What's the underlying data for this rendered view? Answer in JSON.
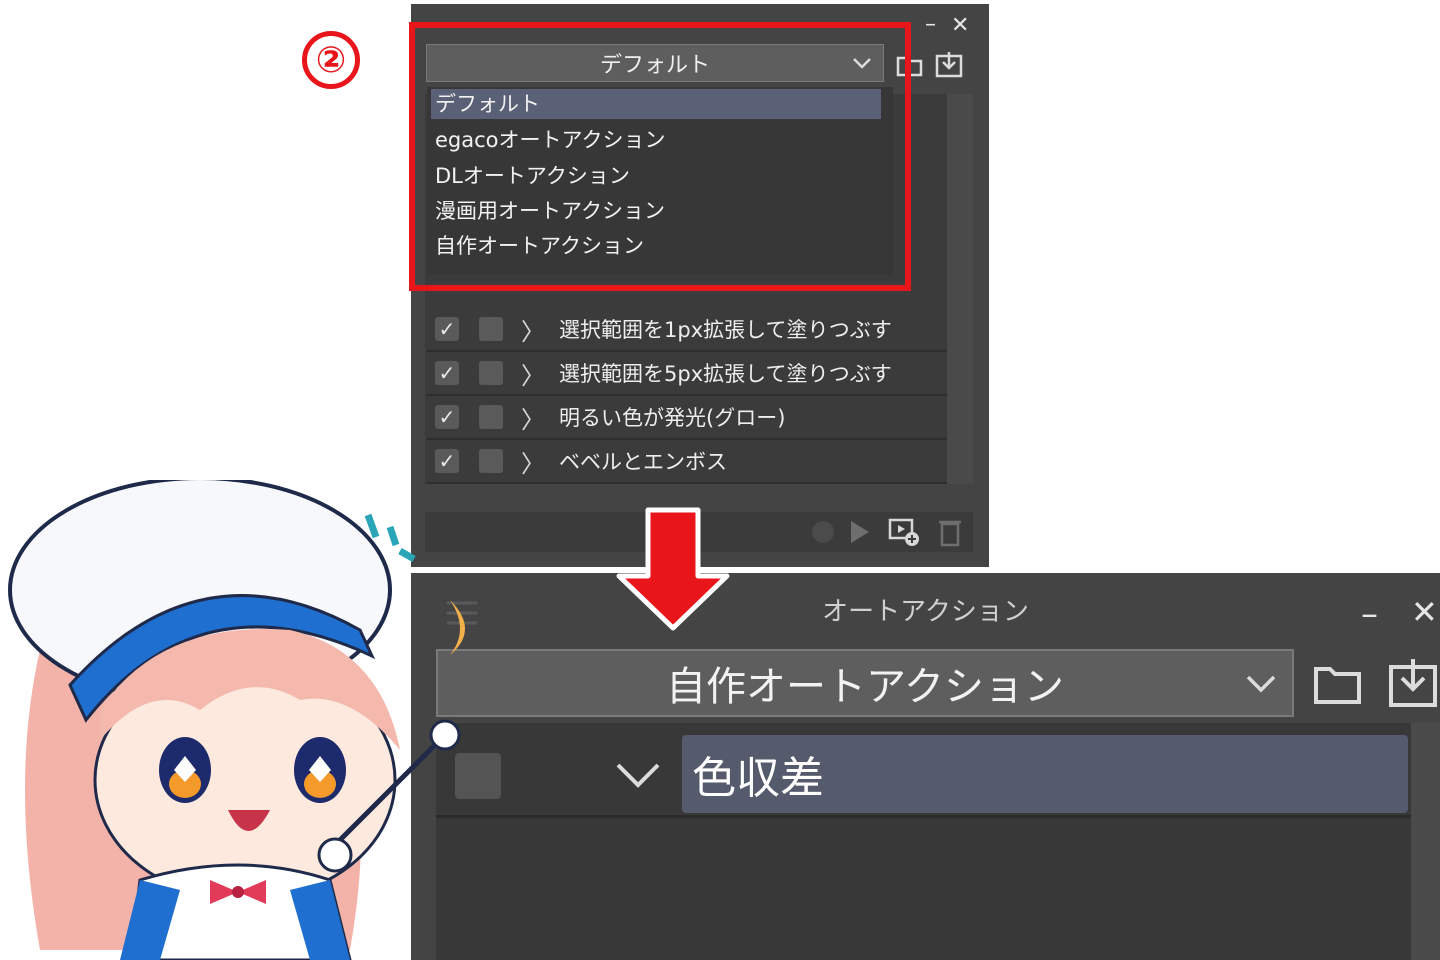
{
  "step_number": "②",
  "top_panel": {
    "dropdown_value": "デフォルト",
    "dropdown_options": [
      "デフォルト",
      "egacoオートアクション",
      "DLオートアクション",
      "漫画用オートアクション",
      "自作オートアクション"
    ],
    "selected_option": "デフォルト",
    "rows": [
      {
        "label": "選択範囲を1px拡張して塗りつぶす",
        "checked": true
      },
      {
        "label": "選択範囲を5px拡張して塗りつぶす",
        "checked": true
      },
      {
        "label": "明るい色が発光(グロー)",
        "checked": true
      },
      {
        "label": "ベベルとエンボス",
        "checked": true
      }
    ],
    "check_mark": "✓",
    "chevron_right": "〉",
    "minimize": "–",
    "close": "✕"
  },
  "bottom_panel": {
    "title": "オートアクション",
    "dropdown_value": "自作オートアクション",
    "action_set_name": "色収差",
    "minimize": "–",
    "close": "✕"
  },
  "colors": {
    "panel_bg": "#444444",
    "highlight_red": "#e8161b",
    "selected_row": "#5a6075"
  }
}
